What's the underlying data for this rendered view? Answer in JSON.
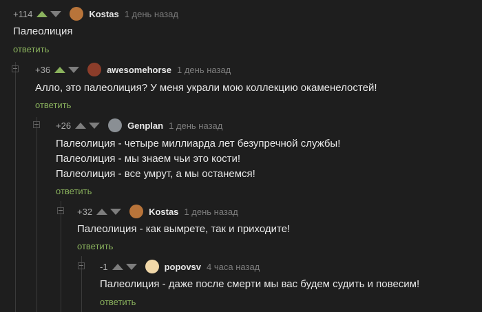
{
  "comments": [
    {
      "rating": "+114",
      "user": "Kostas",
      "time": "1 день назад",
      "lines": [
        "Палеолиция"
      ],
      "reply": "ответить",
      "avatar_color": "#b8743a"
    },
    {
      "rating": "+36",
      "user": "awesomehorse",
      "time": "1 день назад",
      "lines": [
        "Алло, это палеолиция? У меня украли мою коллекцию окаменелостей!"
      ],
      "reply": "ответить",
      "avatar_color": "#8c3d2a"
    },
    {
      "rating": "+26",
      "user": "Genplan",
      "time": "1 день назад",
      "lines": [
        "Палеолиция -  четыре миллиарда лет безупречной службы!",
        "Палеолиция - мы знаем чьи это кости!",
        "Палеолиция - все умрут, а мы останемся!"
      ],
      "reply": "ответить",
      "avatar_color": "#8a8f94"
    },
    {
      "rating": "+32",
      "user": "Kostas",
      "time": "1 день назад",
      "lines": [
        "Палеолиция - как вымрете, так и приходите!"
      ],
      "reply": "ответить",
      "avatar_color": "#b8743a"
    },
    {
      "rating": "-1",
      "user": "popovsv",
      "time": "4 часа назад",
      "lines": [
        "Палеолиция - даже после смерти мы вас будем судить и повесим!"
      ],
      "reply": "ответить",
      "avatar_color": "#f0d7a8"
    }
  ]
}
